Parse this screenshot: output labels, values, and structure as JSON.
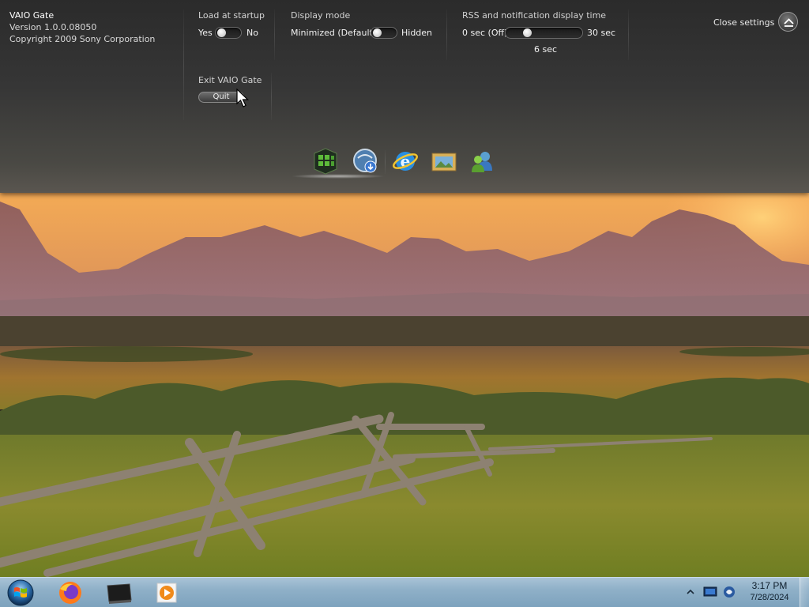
{
  "app": {
    "name": "VAIO Gate",
    "version": "Version 1.0.0.08050",
    "copyright": "Copyright 2009 Sony Corporation"
  },
  "startup": {
    "title": "Load at startup",
    "yes_label": "Yes",
    "no_label": "No",
    "selected": "Yes"
  },
  "display_mode": {
    "title": "Display mode",
    "minimized_label": "Minimized (Default)",
    "hidden_label": "Hidden",
    "selected": "Minimized (Default)"
  },
  "rss": {
    "title": "RSS and notification display time",
    "min_label": "0 sec (Off)",
    "max_label": "30 sec",
    "current_label": "6 sec",
    "value_sec": 6,
    "max_sec": 30
  },
  "exit": {
    "title": "Exit VAIO Gate",
    "quit_label": "Quit"
  },
  "close": {
    "label": "Close settings"
  },
  "dock": {
    "icons": [
      "media-center-icon",
      "vaio-update-icon",
      "internet-explorer-icon",
      "photo-icon",
      "messenger-icon"
    ]
  },
  "taskbar": {
    "pinned": [
      "firefox-icon",
      "vaio-gate-icon",
      "media-player-icon"
    ],
    "time": "3:17 PM",
    "date": "7/28/2024",
    "tray_icons": [
      "show-hidden-icons-arrow-icon",
      "network-icon",
      "action-center-icon"
    ]
  },
  "colors": {
    "panel": "#363636",
    "taskbar": "#8fb0c8",
    "sky_glow": "#f0a24a"
  }
}
